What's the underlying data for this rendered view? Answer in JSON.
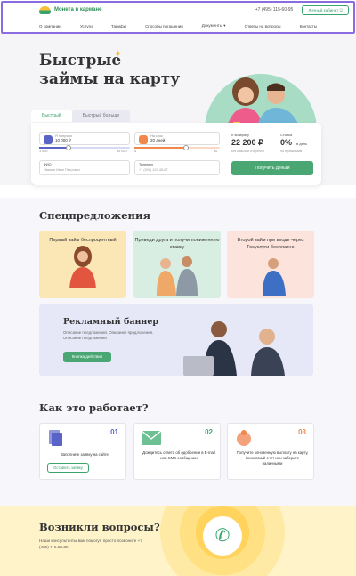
{
  "header": {
    "brand": "Монета в кармане",
    "phone": "+7 (495) 115-60-95",
    "cabinet": "Личный кабинет"
  },
  "nav": [
    "О компании",
    "Услуги",
    "Тарифы",
    "Способы погашения",
    "Документы",
    "Ответы на вопросы",
    "Контакты"
  ],
  "hero": {
    "title": "Быстрые займы на карту"
  },
  "form": {
    "tabs": [
      "Быстрый",
      "Быстрый больше"
    ],
    "amount": {
      "label": "Я получаю",
      "value": "10 000 ₽",
      "min": "1 000",
      "max": "30 000",
      "level": 0.32
    },
    "term": {
      "label": "На срок",
      "value": "20 дней",
      "min": "5",
      "max": "30",
      "level": 0.6
    },
    "name": {
      "label": "ФИО",
      "placeholder": "Иванов Иван Петрович"
    },
    "phone": {
      "label": "Телефон",
      "placeholder": "+7 (900) 123-45-67"
    },
    "repay_label": "К возврату",
    "repay_value": "22 200 ₽",
    "repay_note": "Без комиссий и переплат",
    "rate_label": "Ставка",
    "rate_value": "0%",
    "rate_unit": "в день",
    "rate_note": "На первый займ",
    "submit": "Получить деньги"
  },
  "offers": {
    "title": "Спецпредложения",
    "items": [
      {
        "text": "Первый займ беспроцентный",
        "color": "#fbe7b6"
      },
      {
        "text": "Приведи друга и получи пониженную ставку",
        "color": "#d9eee2"
      },
      {
        "text": "Второй займ при входе через Госуслуги бесплатно",
        "color": "#fce3dc"
      }
    ]
  },
  "banner": {
    "title": "Рекламный баннер",
    "text": "Описание предложения. Описание предложения. Описание предложения",
    "button": "Кнопка действия"
  },
  "how": {
    "title": "Как это работает?",
    "steps": [
      {
        "num": "01",
        "text": "Заполните заявку на сайте",
        "button": "Оставить заявку",
        "color": "#5a64c8"
      },
      {
        "num": "02",
        "text": "Дождитесь ответа об одобрении в E-mail или SMS сообщении",
        "color": "#3aa36c"
      },
      {
        "num": "03",
        "text": "Получите мгновенную выплату на карту, банковский счёт или заберите наличными",
        "color": "#f2874a"
      }
    ]
  },
  "questions": {
    "title": "Возникли вопросы?",
    "text": "Наши консультанты вам помогут, просто позвоните +7 (495) 115-60-95"
  },
  "colors": {
    "accent": "#3aa36c",
    "violet": "#5a64c8",
    "orange": "#f2874a"
  }
}
